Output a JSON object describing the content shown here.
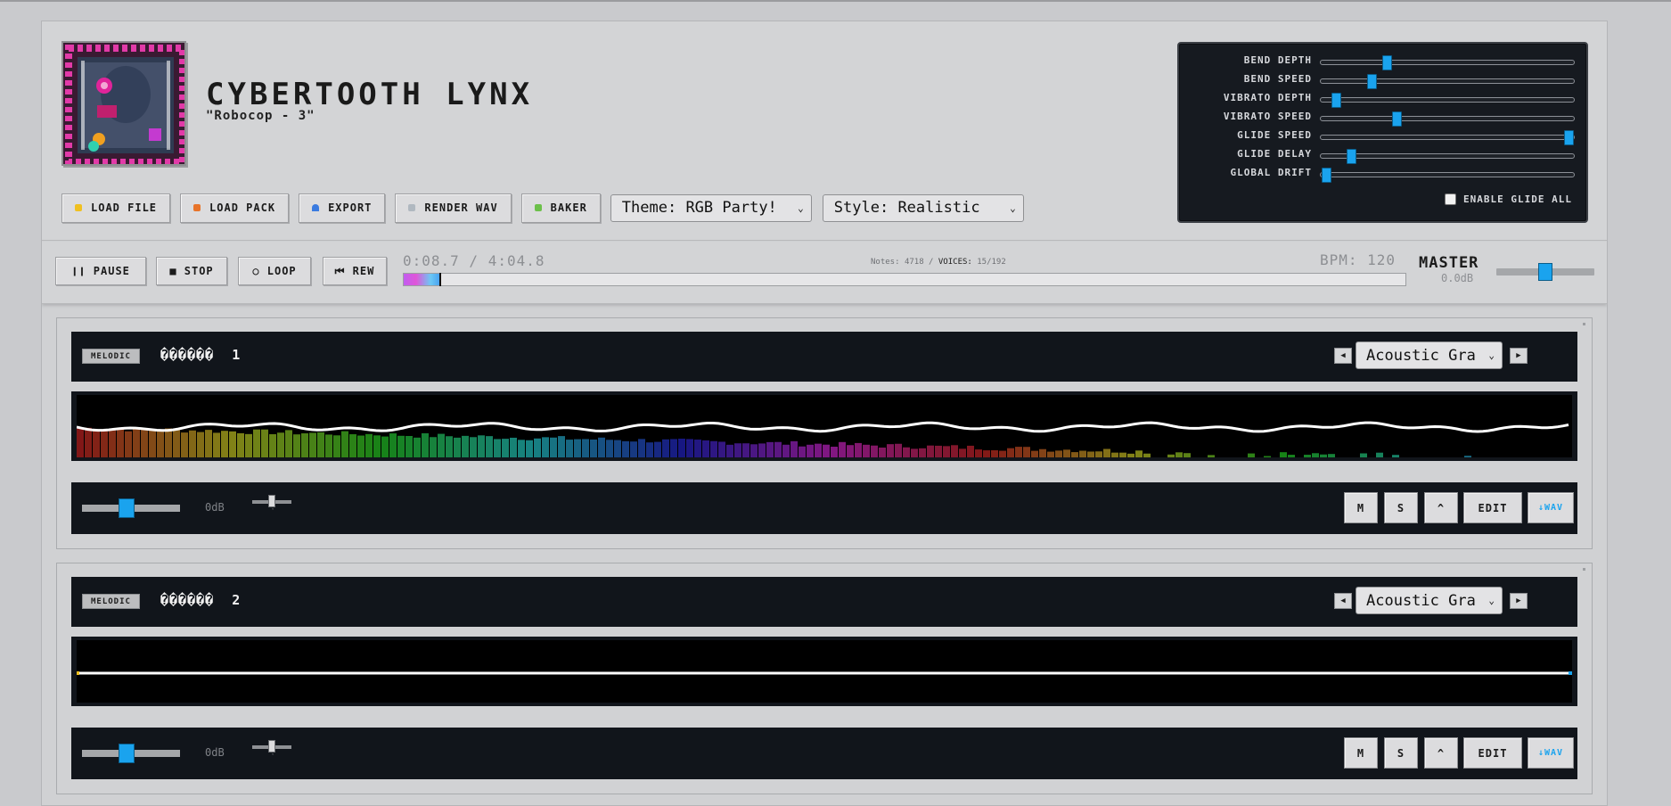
{
  "header": {
    "title": "CYBERTOOTH LYNX",
    "subtitle": "\"Robocop - 3\"",
    "buttons": [
      {
        "label": "LOAD FILE",
        "icon": "folder-icon",
        "color": "#f0c020"
      },
      {
        "label": "LOAD PACK",
        "icon": "pack-icon",
        "color": "#e8742a"
      },
      {
        "label": "EXPORT",
        "icon": "export-icon",
        "color": "#3a7be0"
      },
      {
        "label": "RENDER WAV",
        "icon": "render-icon",
        "color": "#b0b8c0"
      },
      {
        "label": "BAKER",
        "icon": "baker-icon",
        "color": "#6cc04a"
      }
    ],
    "theme_select": "Theme: RGB Party!",
    "style_select": "Style: Realistic"
  },
  "fx": {
    "sliders": [
      {
        "label": "BEND DEPTH",
        "value": 0.26
      },
      {
        "label": "BEND SPEED",
        "value": 0.2
      },
      {
        "label": "VIBRATO DEPTH",
        "value": 0.06
      },
      {
        "label": "VIBRATO SPEED",
        "value": 0.3
      },
      {
        "label": "GLIDE SPEED",
        "value": 0.98
      },
      {
        "label": "GLIDE DELAY",
        "value": 0.12
      },
      {
        "label": "GLOBAL DRIFT",
        "value": 0.02
      }
    ],
    "glide_all_label": "ENABLE GLIDE ALL",
    "glide_all_checked": false
  },
  "transport": {
    "pause": "❙❙ PAUSE",
    "stop": "■ STOP",
    "loop": "○ LOOP",
    "rew": "⏮ REW",
    "time": "0:08.7 / 4:04.8",
    "notes_label": "Notes:",
    "notes_value": "4718",
    "voices_label": "VOICES:",
    "voices_value": "15/192",
    "bpm": "BPM: 120",
    "progress": 0.036,
    "master_label": "MASTER",
    "master_db": "0.0dB",
    "master_level": 0.5
  },
  "tracks": [
    {
      "tag": "MELODIC",
      "name_glyphs": "������",
      "number": "1",
      "instrument": "Acoustic Gra",
      "volume_db": "0dB",
      "volume": 0.45,
      "buttons": {
        "mute": "M",
        "solo": "S",
        "up": "^",
        "edit": "EDIT",
        "wav": "↓WAV"
      },
      "has_activity": true
    },
    {
      "tag": "MELODIC",
      "name_glyphs": "������",
      "number": "2",
      "instrument": "Acoustic Gra",
      "volume_db": "0dB",
      "volume": 0.45,
      "buttons": {
        "mute": "M",
        "solo": "S",
        "up": "^",
        "edit": "EDIT",
        "wav": "↓WAV"
      },
      "has_activity": false
    }
  ],
  "colors": {
    "accent": "#1aa3ee",
    "panel": "#11151b",
    "progress_start": "#c15cf0",
    "progress_end": "#4aa3f0"
  }
}
